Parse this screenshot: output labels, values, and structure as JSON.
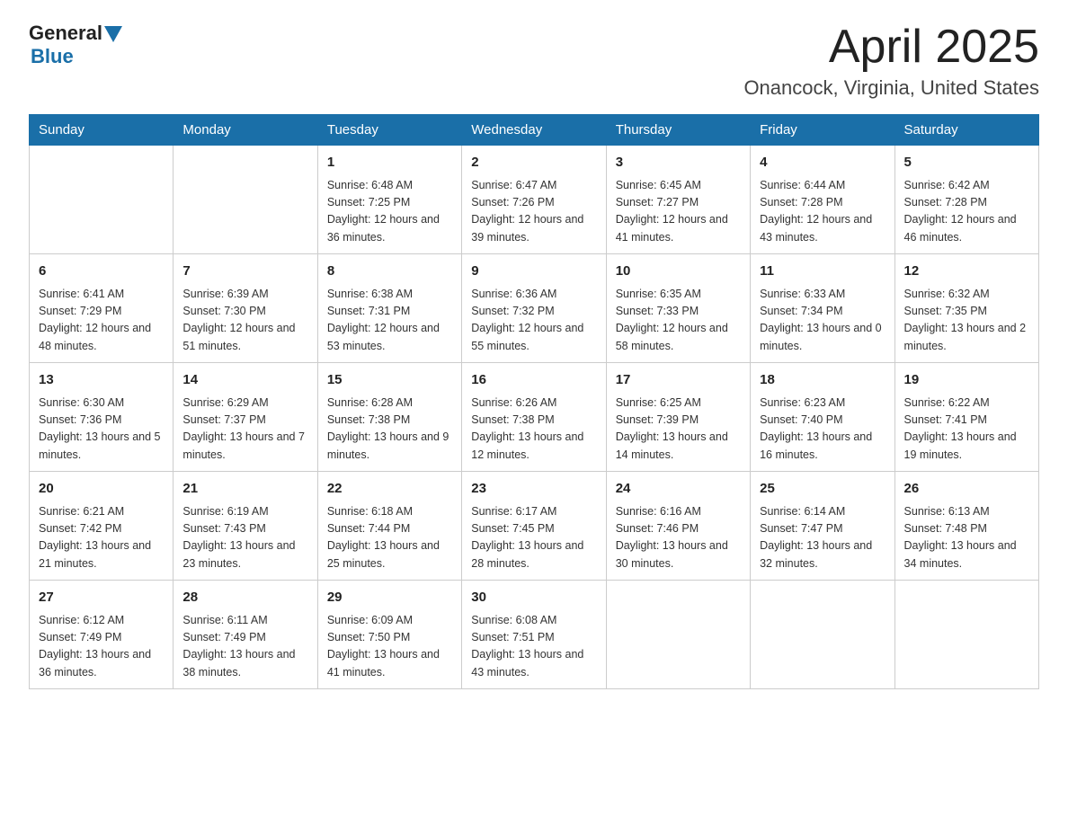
{
  "logo": {
    "general": "General",
    "blue": "Blue"
  },
  "title": "April 2025",
  "subtitle": "Onancock, Virginia, United States",
  "weekdays": [
    "Sunday",
    "Monday",
    "Tuesday",
    "Wednesday",
    "Thursday",
    "Friday",
    "Saturday"
  ],
  "weeks": [
    [
      {
        "day": "",
        "sunrise": "",
        "sunset": "",
        "daylight": ""
      },
      {
        "day": "",
        "sunrise": "",
        "sunset": "",
        "daylight": ""
      },
      {
        "day": "1",
        "sunrise": "Sunrise: 6:48 AM",
        "sunset": "Sunset: 7:25 PM",
        "daylight": "Daylight: 12 hours and 36 minutes."
      },
      {
        "day": "2",
        "sunrise": "Sunrise: 6:47 AM",
        "sunset": "Sunset: 7:26 PM",
        "daylight": "Daylight: 12 hours and 39 minutes."
      },
      {
        "day": "3",
        "sunrise": "Sunrise: 6:45 AM",
        "sunset": "Sunset: 7:27 PM",
        "daylight": "Daylight: 12 hours and 41 minutes."
      },
      {
        "day": "4",
        "sunrise": "Sunrise: 6:44 AM",
        "sunset": "Sunset: 7:28 PM",
        "daylight": "Daylight: 12 hours and 43 minutes."
      },
      {
        "day": "5",
        "sunrise": "Sunrise: 6:42 AM",
        "sunset": "Sunset: 7:28 PM",
        "daylight": "Daylight: 12 hours and 46 minutes."
      }
    ],
    [
      {
        "day": "6",
        "sunrise": "Sunrise: 6:41 AM",
        "sunset": "Sunset: 7:29 PM",
        "daylight": "Daylight: 12 hours and 48 minutes."
      },
      {
        "day": "7",
        "sunrise": "Sunrise: 6:39 AM",
        "sunset": "Sunset: 7:30 PM",
        "daylight": "Daylight: 12 hours and 51 minutes."
      },
      {
        "day": "8",
        "sunrise": "Sunrise: 6:38 AM",
        "sunset": "Sunset: 7:31 PM",
        "daylight": "Daylight: 12 hours and 53 minutes."
      },
      {
        "day": "9",
        "sunrise": "Sunrise: 6:36 AM",
        "sunset": "Sunset: 7:32 PM",
        "daylight": "Daylight: 12 hours and 55 minutes."
      },
      {
        "day": "10",
        "sunrise": "Sunrise: 6:35 AM",
        "sunset": "Sunset: 7:33 PM",
        "daylight": "Daylight: 12 hours and 58 minutes."
      },
      {
        "day": "11",
        "sunrise": "Sunrise: 6:33 AM",
        "sunset": "Sunset: 7:34 PM",
        "daylight": "Daylight: 13 hours and 0 minutes."
      },
      {
        "day": "12",
        "sunrise": "Sunrise: 6:32 AM",
        "sunset": "Sunset: 7:35 PM",
        "daylight": "Daylight: 13 hours and 2 minutes."
      }
    ],
    [
      {
        "day": "13",
        "sunrise": "Sunrise: 6:30 AM",
        "sunset": "Sunset: 7:36 PM",
        "daylight": "Daylight: 13 hours and 5 minutes."
      },
      {
        "day": "14",
        "sunrise": "Sunrise: 6:29 AM",
        "sunset": "Sunset: 7:37 PM",
        "daylight": "Daylight: 13 hours and 7 minutes."
      },
      {
        "day": "15",
        "sunrise": "Sunrise: 6:28 AM",
        "sunset": "Sunset: 7:38 PM",
        "daylight": "Daylight: 13 hours and 9 minutes."
      },
      {
        "day": "16",
        "sunrise": "Sunrise: 6:26 AM",
        "sunset": "Sunset: 7:38 PM",
        "daylight": "Daylight: 13 hours and 12 minutes."
      },
      {
        "day": "17",
        "sunrise": "Sunrise: 6:25 AM",
        "sunset": "Sunset: 7:39 PM",
        "daylight": "Daylight: 13 hours and 14 minutes."
      },
      {
        "day": "18",
        "sunrise": "Sunrise: 6:23 AM",
        "sunset": "Sunset: 7:40 PM",
        "daylight": "Daylight: 13 hours and 16 minutes."
      },
      {
        "day": "19",
        "sunrise": "Sunrise: 6:22 AM",
        "sunset": "Sunset: 7:41 PM",
        "daylight": "Daylight: 13 hours and 19 minutes."
      }
    ],
    [
      {
        "day": "20",
        "sunrise": "Sunrise: 6:21 AM",
        "sunset": "Sunset: 7:42 PM",
        "daylight": "Daylight: 13 hours and 21 minutes."
      },
      {
        "day": "21",
        "sunrise": "Sunrise: 6:19 AM",
        "sunset": "Sunset: 7:43 PM",
        "daylight": "Daylight: 13 hours and 23 minutes."
      },
      {
        "day": "22",
        "sunrise": "Sunrise: 6:18 AM",
        "sunset": "Sunset: 7:44 PM",
        "daylight": "Daylight: 13 hours and 25 minutes."
      },
      {
        "day": "23",
        "sunrise": "Sunrise: 6:17 AM",
        "sunset": "Sunset: 7:45 PM",
        "daylight": "Daylight: 13 hours and 28 minutes."
      },
      {
        "day": "24",
        "sunrise": "Sunrise: 6:16 AM",
        "sunset": "Sunset: 7:46 PM",
        "daylight": "Daylight: 13 hours and 30 minutes."
      },
      {
        "day": "25",
        "sunrise": "Sunrise: 6:14 AM",
        "sunset": "Sunset: 7:47 PM",
        "daylight": "Daylight: 13 hours and 32 minutes."
      },
      {
        "day": "26",
        "sunrise": "Sunrise: 6:13 AM",
        "sunset": "Sunset: 7:48 PM",
        "daylight": "Daylight: 13 hours and 34 minutes."
      }
    ],
    [
      {
        "day": "27",
        "sunrise": "Sunrise: 6:12 AM",
        "sunset": "Sunset: 7:49 PM",
        "daylight": "Daylight: 13 hours and 36 minutes."
      },
      {
        "day": "28",
        "sunrise": "Sunrise: 6:11 AM",
        "sunset": "Sunset: 7:49 PM",
        "daylight": "Daylight: 13 hours and 38 minutes."
      },
      {
        "day": "29",
        "sunrise": "Sunrise: 6:09 AM",
        "sunset": "Sunset: 7:50 PM",
        "daylight": "Daylight: 13 hours and 41 minutes."
      },
      {
        "day": "30",
        "sunrise": "Sunrise: 6:08 AM",
        "sunset": "Sunset: 7:51 PM",
        "daylight": "Daylight: 13 hours and 43 minutes."
      },
      {
        "day": "",
        "sunrise": "",
        "sunset": "",
        "daylight": ""
      },
      {
        "day": "",
        "sunrise": "",
        "sunset": "",
        "daylight": ""
      },
      {
        "day": "",
        "sunrise": "",
        "sunset": "",
        "daylight": ""
      }
    ]
  ]
}
